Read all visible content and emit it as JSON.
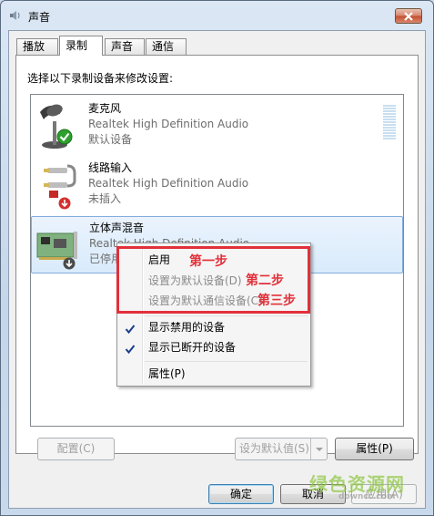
{
  "window": {
    "title": "声音",
    "close_icon": "close-icon"
  },
  "tabs": [
    {
      "label": "播放",
      "active": false
    },
    {
      "label": "录制",
      "active": true
    },
    {
      "label": "声音",
      "active": false
    },
    {
      "label": "通信",
      "active": false
    }
  ],
  "panel": {
    "instruction": "选择以下录制设备来修改设置:"
  },
  "devices": [
    {
      "name": "麦克风",
      "description": "Realtek High Definition Audio",
      "status": "默认设备",
      "icon": "microphone-icon",
      "badge": "default-check-icon"
    },
    {
      "name": "线路输入",
      "description": "Realtek High Definition Audio",
      "status": "未插入",
      "icon": "line-in-cable-icon",
      "badge": "unplugged-arrow-icon"
    },
    {
      "name": "立体声混音",
      "description": "Realtek High Definition Audio",
      "status": "已停用",
      "icon": "sound-card-icon",
      "badge": "disabled-arrow-icon",
      "selected": true
    }
  ],
  "context_menu": {
    "items": [
      {
        "label": "启用",
        "disabled": false,
        "checked": false
      },
      {
        "label": "设置为默认设备(D)",
        "disabled": true,
        "checked": false
      },
      {
        "label": "设置为默认通信设备(C)",
        "disabled": true,
        "checked": false
      },
      {
        "label": "显示禁用的设备",
        "disabled": false,
        "checked": true
      },
      {
        "label": "显示已断开的设备",
        "disabled": false,
        "checked": true
      },
      {
        "label": "属性(P)",
        "disabled": false,
        "checked": false
      }
    ]
  },
  "annotations": {
    "step1": "第一步",
    "step2": "第二步",
    "step3": "第三步",
    "color": "#e2303a"
  },
  "buttons": {
    "configure": "配置(C)",
    "set_default": "设为默认值(S)",
    "properties": "属性(P)",
    "ok": "确定",
    "cancel": "取消",
    "apply": "应用(A)"
  },
  "watermark": {
    "main": "绿色资源网",
    "url": "downcc.com"
  }
}
